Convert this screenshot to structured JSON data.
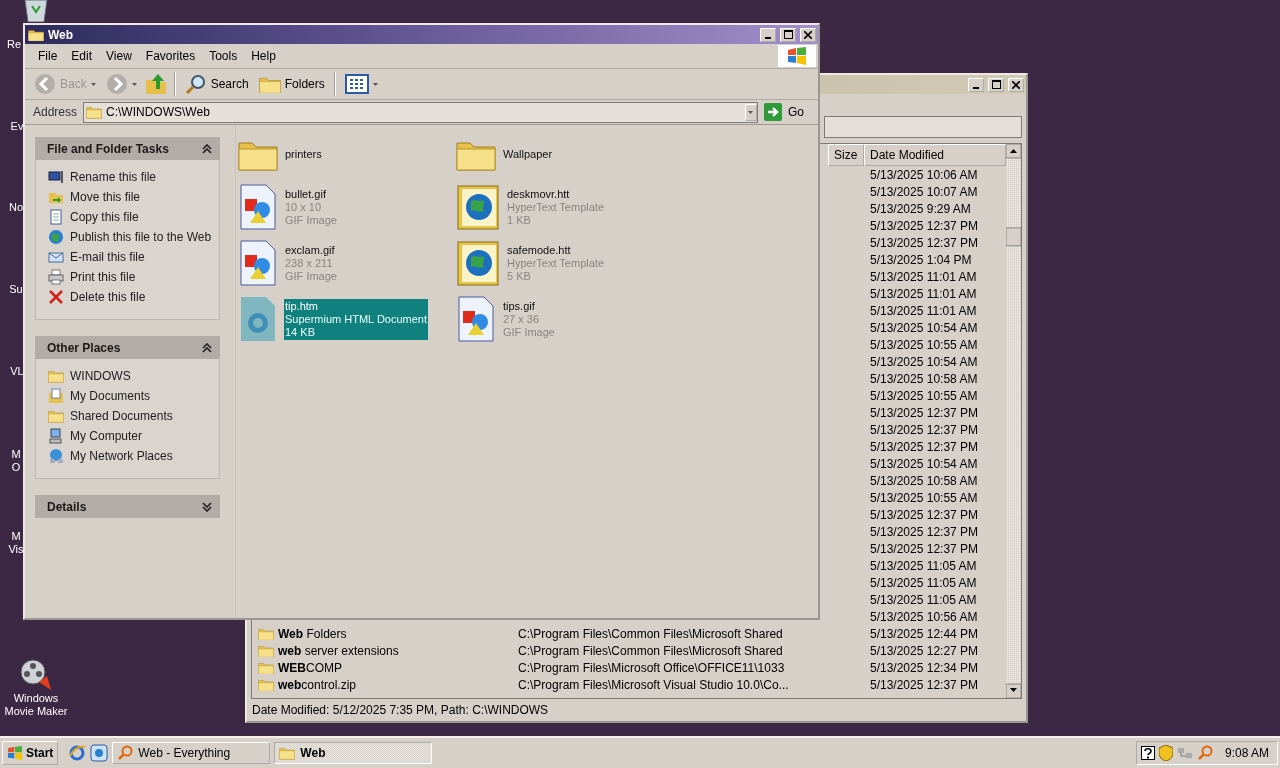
{
  "desktop": {
    "icons": [
      {
        "lines": [
          "Re"
        ]
      },
      {
        "lines": [
          "Ev"
        ]
      },
      {
        "lines": [
          "No"
        ]
      },
      {
        "lines": [
          "Su"
        ]
      },
      {
        "lines": [
          "VL"
        ]
      },
      {
        "lines": [
          "M",
          "O"
        ]
      },
      {
        "lines": [
          "M",
          "Vis"
        ]
      },
      {
        "lines": [
          "Windows",
          "Movie Maker"
        ]
      }
    ]
  },
  "back_window": {
    "columns": [
      "Size",
      "Date Modified"
    ],
    "rows": [
      {
        "date": "5/13/2025 10:06 AM"
      },
      {
        "date": "5/13/2025 10:07 AM"
      },
      {
        "date": "5/13/2025 9:29 AM"
      },
      {
        "date": "5/13/2025 12:37 PM"
      },
      {
        "date": "5/13/2025 12:37 PM"
      },
      {
        "date": "5/13/2025 1:04 PM"
      },
      {
        "date": "5/13/2025 11:01 AM"
      },
      {
        "date": "5/13/2025 11:01 AM"
      },
      {
        "date": "5/13/2025 11:01 AM"
      },
      {
        "date": "5/13/2025 10:54 AM"
      },
      {
        "date": "5/13/2025 10:55 AM"
      },
      {
        "date": "5/13/2025 10:54 AM"
      },
      {
        "date": "5/13/2025 10:58 AM"
      },
      {
        "date": "5/13/2025 10:55 AM"
      },
      {
        "date": "5/13/2025 12:37 PM"
      },
      {
        "date": "5/13/2025 12:37 PM"
      },
      {
        "date": "5/13/2025 12:37 PM"
      },
      {
        "date": "5/13/2025 10:54 AM"
      },
      {
        "date": "5/13/2025 10:58 AM"
      },
      {
        "date": "5/13/2025 10:55 AM"
      },
      {
        "date": "5/13/2025 12:37 PM"
      },
      {
        "date": "5/13/2025 12:37 PM"
      },
      {
        "date": "5/13/2025 12:37 PM"
      },
      {
        "date": "5/13/2025 11:05 AM"
      },
      {
        "date": "5/13/2025 11:05 AM"
      },
      {
        "date": "5/13/2025 11:05 AM"
      },
      {
        "date": "5/13/2025 10:56 AM"
      },
      {
        "name": "**Web** Folders",
        "path": "C:\\Program Files\\Common Files\\Microsoft Shared",
        "date": "5/13/2025 12:44 PM"
      },
      {
        "name": "**web** server extensions",
        "path": "C:\\Program Files\\Common Files\\Microsoft Shared",
        "date": "5/13/2025 12:27 PM"
      },
      {
        "name": "**WEB**COMP",
        "path": "C:\\Program Files\\Microsoft Office\\OFFICE11\\1033",
        "date": "5/13/2025 12:34 PM"
      },
      {
        "name": "**web**control.zip",
        "path": "C:\\Program Files\\Microsoft Visual Studio 10.0\\Co...",
        "date": "5/13/2025 12:37 PM"
      }
    ],
    "status": "Date Modified: 5/12/2025 7:35 PM, Path: C:\\WINDOWS"
  },
  "front_window": {
    "title": "Web",
    "menu": [
      "File",
      "Edit",
      "View",
      "Favorites",
      "Tools",
      "Help"
    ],
    "toolbar": {
      "back": {
        "label": "Back",
        "disabled": true
      },
      "search": "Search",
      "folders": "Folders"
    },
    "address": {
      "label": "Address",
      "value": "C:\\WINDOWS\\Web",
      "go": "Go"
    },
    "panels": [
      {
        "title": "File and Folder Tasks",
        "expanded": true,
        "items": [
          "Rename this file",
          "Move this file",
          "Copy this file",
          "Publish this file to the Web",
          "E-mail this file",
          "Print this file",
          "Delete this file"
        ]
      },
      {
        "title": "Other Places",
        "expanded": true,
        "items": [
          "WINDOWS",
          "My Documents",
          "Shared Documents",
          "My Computer",
          "My Network Places"
        ]
      },
      {
        "title": "Details",
        "expanded": false
      }
    ],
    "files": [
      {
        "kind": "folder",
        "name": "printers",
        "selected": false
      },
      {
        "kind": "folder",
        "name": "Wallpaper",
        "selected": false
      },
      {
        "kind": "image",
        "name": "bullet.gif",
        "details": [
          "10 x 10",
          "GIF Image"
        ],
        "selected": false
      },
      {
        "kind": "template",
        "name": "deskmovr.htt",
        "details": [
          "HyperText Template",
          "1 KB"
        ],
        "selected": false
      },
      {
        "kind": "image",
        "name": "exclam.gif",
        "details": [
          "238 x 211",
          "GIF Image"
        ],
        "selected": false
      },
      {
        "kind": "template",
        "name": "safemode.htt",
        "details": [
          "HyperText Template",
          "5 KB"
        ],
        "selected": false
      },
      {
        "kind": "htm",
        "name": "tip.htm",
        "details": [
          "Supermium HTML Document",
          "14 KB"
        ],
        "selected": true
      },
      {
        "kind": "image",
        "name": "tips.gif",
        "details": [
          "27 x 36",
          "GIF Image"
        ],
        "selected": false
      }
    ]
  },
  "taskbar": {
    "start": "Start",
    "tasks": [
      {
        "label": "Web - Everything",
        "selected": false
      },
      {
        "label": "Web",
        "selected": true
      }
    ],
    "clock": "9:08 AM"
  }
}
